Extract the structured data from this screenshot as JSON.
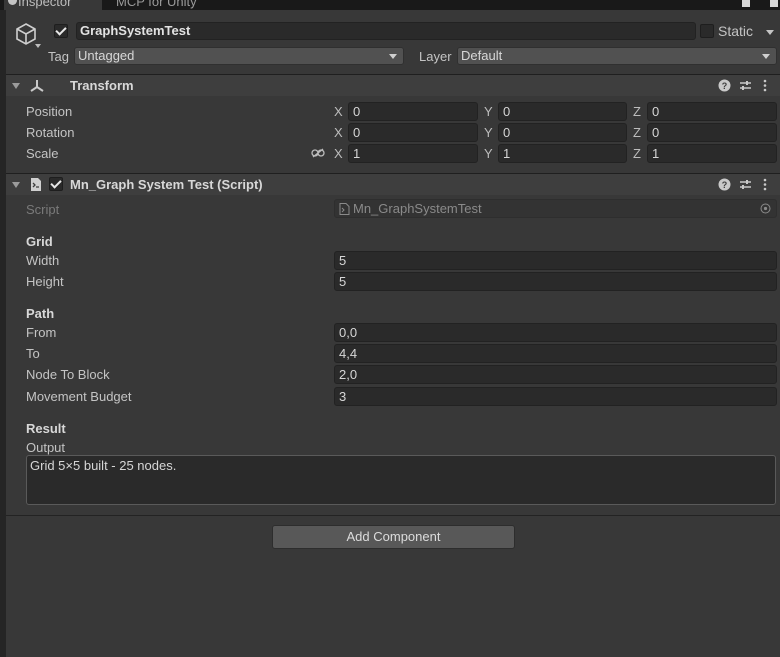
{
  "tabs": [
    {
      "label": "Inspector",
      "active": true
    },
    {
      "label": "MCP for Unity",
      "active": false
    }
  ],
  "header": {
    "active": true,
    "name": "GraphSystemTest",
    "static_label": "Static",
    "static_checked": false,
    "tag_label": "Tag",
    "tag_value": "Untagged",
    "layer_label": "Layer",
    "layer_value": "Default"
  },
  "transform": {
    "title": "Transform",
    "rows": [
      {
        "label": "Position",
        "x": "0",
        "y": "0",
        "z": "0"
      },
      {
        "label": "Rotation",
        "x": "0",
        "y": "0",
        "z": "0"
      },
      {
        "label": "Scale",
        "x": "1",
        "y": "1",
        "z": "1"
      }
    ],
    "axis_labels": [
      "X",
      "Y",
      "Z"
    ]
  },
  "script_component": {
    "title": "Mn_Graph System Test (Script)",
    "enabled": true,
    "script_label": "Script",
    "script_value": "Mn_GraphSystemTest",
    "grid": {
      "header": "Grid",
      "width_label": "Width",
      "width": "5",
      "height_label": "Height",
      "height": "5"
    },
    "path": {
      "header": "Path",
      "from_label": "From",
      "from": "0,0",
      "to_label": "To",
      "to": "4,4",
      "block_label": "Node To Block",
      "block": "2,0",
      "budget_label": "Movement Budget",
      "budget": "3"
    },
    "result": {
      "header": "Result",
      "output_label": "Output",
      "output": "Grid 5×5 built - 25 nodes."
    }
  },
  "add_component_label": "Add Component",
  "colors": {
    "background": "#383838",
    "field": "#2a2a2a",
    "header": "#3e3e3e",
    "button": "#585858"
  }
}
